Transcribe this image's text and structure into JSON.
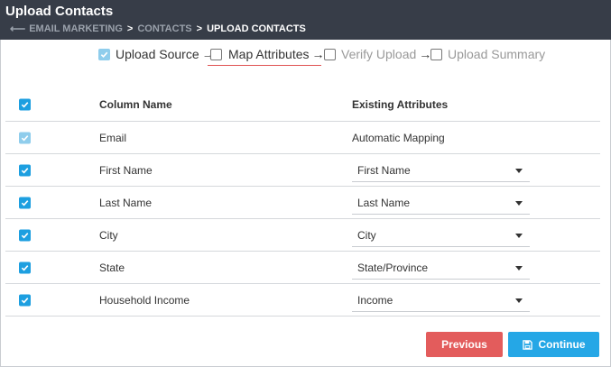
{
  "header": {
    "title": "Upload Contacts",
    "breadcrumb": {
      "back_icon": "arrow-left-icon",
      "items": [
        "EMAIL MARKETING",
        "CONTACTS"
      ],
      "separator": ">",
      "current": "UPLOAD CONTACTS"
    }
  },
  "steps": [
    {
      "label": "Upload Source",
      "state": "checked",
      "arrow": "→"
    },
    {
      "label": "Map Attributes",
      "state": "unchecked",
      "arrow": "→"
    },
    {
      "label": "Verify Upload",
      "state": "unchecked",
      "arrow": "→"
    },
    {
      "label": "Upload Summary",
      "state": "unchecked"
    }
  ],
  "table": {
    "headers": {
      "column_name": "Column Name",
      "existing_attributes": "Existing Attributes"
    },
    "rows": [
      {
        "column": "Email",
        "attribute": "Automatic Mapping",
        "checked": true,
        "disabled": true,
        "type": "text"
      },
      {
        "column": "First Name",
        "attribute": "First Name",
        "checked": true,
        "type": "select"
      },
      {
        "column": "Last Name",
        "attribute": "Last Name",
        "checked": true,
        "type": "select"
      },
      {
        "column": "City",
        "attribute": "City",
        "checked": true,
        "type": "select"
      },
      {
        "column": "State",
        "attribute": "State/Province",
        "checked": true,
        "type": "select"
      },
      {
        "column": "Household Income",
        "attribute": "Income",
        "checked": true,
        "type": "select"
      }
    ]
  },
  "buttons": {
    "previous": "Previous",
    "continue": "Continue",
    "continue_icon": "save-icon"
  },
  "colors": {
    "header_bg": "#373d48",
    "accent_blue": "#25a7e6",
    "checkbox_blue": "#1d9fe0",
    "previous_red": "#e35c5c",
    "active_step_underline": "#e05252"
  }
}
